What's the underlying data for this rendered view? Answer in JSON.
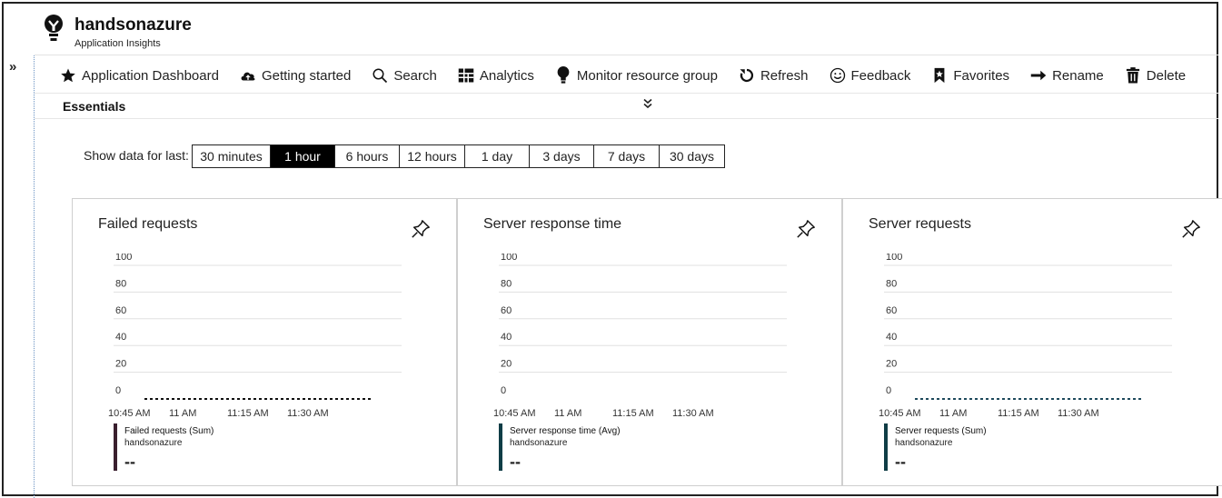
{
  "app": {
    "title": "handsonazure",
    "subtitle": "Application Insights",
    "icon": "lightbulb-icon"
  },
  "left_strip": {
    "expand_label": "»"
  },
  "toolbar": {
    "items": [
      {
        "label": "Application Dashboard",
        "icon": "star-icon"
      },
      {
        "label": "Getting started",
        "icon": "cloud-upload-icon"
      },
      {
        "label": "Search",
        "icon": "search-icon"
      },
      {
        "label": "Analytics",
        "icon": "grid-icon"
      },
      {
        "label": "Monitor resource group",
        "icon": "lightbulb-icon"
      },
      {
        "label": "Refresh",
        "icon": "refresh-icon"
      },
      {
        "label": "Feedback",
        "icon": "smiley-icon"
      },
      {
        "label": "Favorites",
        "icon": "bookmark-icon"
      },
      {
        "label": "Rename",
        "icon": "arrow-right-icon"
      },
      {
        "label": "Delete",
        "icon": "trash-icon"
      }
    ]
  },
  "essentials": {
    "label": "Essentials",
    "toggle": "chevron-double-down-icon"
  },
  "time_range": {
    "label": "Show data for last:",
    "options": [
      "30 minutes",
      "1 hour",
      "6 hours",
      "12 hours",
      "1 day",
      "3 days",
      "7 days",
      "30 days"
    ],
    "selected": "1 hour"
  },
  "cards": [
    {
      "title": "Failed requests",
      "legend_name": "Failed requests (Sum)",
      "legend_resource": "handsonazure",
      "legend_value": "--",
      "legend_color": "#3a1f2e",
      "series_color": "#111111"
    },
    {
      "title": "Server response time",
      "legend_name": "Server response time (Avg)",
      "legend_resource": "handsonazure",
      "legend_value": "--",
      "legend_color": "#0f3d46",
      "series_color": "#111111"
    },
    {
      "title": "Server requests",
      "legend_name": "Server requests (Sum)",
      "legend_resource": "handsonazure",
      "legend_value": "--",
      "legend_color": "#0f3d46",
      "series_color": "#1f4a5c"
    }
  ],
  "chart_data": [
    {
      "type": "line",
      "title": "Failed requests",
      "y_ticks": [
        "100",
        "80",
        "60",
        "40",
        "20",
        "0"
      ],
      "x_ticks": [
        "10:45 AM",
        "11 AM",
        "11:15 AM",
        "11:30 AM"
      ],
      "ylim": [
        0,
        100
      ],
      "series": [
        {
          "name": "Failed requests (Sum)",
          "values": [
            0,
            0,
            0,
            0
          ]
        }
      ]
    },
    {
      "type": "line",
      "title": "Server response time",
      "y_ticks": [
        "100",
        "80",
        "60",
        "40",
        "20",
        "0"
      ],
      "x_ticks": [
        "10:45 AM",
        "11 AM",
        "11:15 AM",
        "11:30 AM"
      ],
      "ylim": [
        0,
        100
      ],
      "series": [
        {
          "name": "Server response time (Avg)",
          "values": []
        }
      ]
    },
    {
      "type": "line",
      "title": "Server requests",
      "y_ticks": [
        "100",
        "80",
        "60",
        "40",
        "20",
        "0"
      ],
      "x_ticks": [
        "10:45 AM",
        "11 AM",
        "11:15 AM",
        "11:30 AM"
      ],
      "ylim": [
        0,
        100
      ],
      "series": [
        {
          "name": "Server requests (Sum)",
          "values": [
            0,
            0,
            0,
            0
          ]
        }
      ]
    }
  ]
}
